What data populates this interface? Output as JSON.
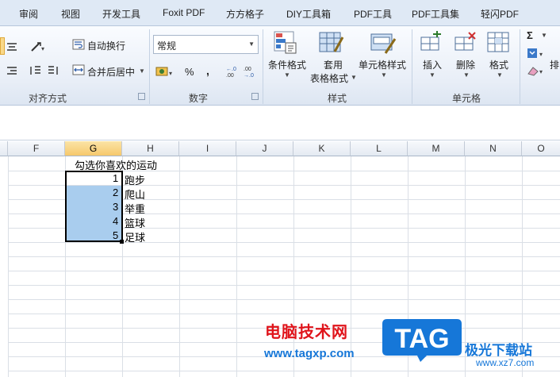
{
  "ribbon_tabs": [
    "审阅",
    "视图",
    "开发工具",
    "Foxit PDF",
    "方方格子",
    "DIY工具箱",
    "PDF工具",
    "PDF工具集",
    "轻闪PDF"
  ],
  "alignment": {
    "wrap_text": "自动换行",
    "merge_center": "合并后居中",
    "group_label": "对齐方式"
  },
  "number": {
    "format_value": "常规",
    "percent": "%",
    "comma": ",",
    "group_label": "数字"
  },
  "styles": {
    "conditional_format": "条件格式",
    "table_format_line1": "套用",
    "table_format_line2": "表格格式",
    "cell_styles": "单元格样式",
    "group_label": "样式"
  },
  "cells_group": {
    "insert": "插入",
    "delete": "删除",
    "format": "格式",
    "group_label": "单元格"
  },
  "editing": {
    "sort_label": "排"
  },
  "columns": [
    "F",
    "G",
    "H",
    "I",
    "J",
    "K",
    "L",
    "M",
    "N",
    "O"
  ],
  "sheet": {
    "title": "勾选你喜欢的运动",
    "rows": [
      {
        "num": "1",
        "sport": "跑步"
      },
      {
        "num": "2",
        "sport": "爬山"
      },
      {
        "num": "3",
        "sport": "举重"
      },
      {
        "num": "4",
        "sport": "篮球"
      },
      {
        "num": "5",
        "sport": "足球"
      }
    ]
  },
  "watermark": {
    "site_name": "电脑技术网",
    "url": "www.tagxp.com",
    "logo_text": "TAG",
    "brand": "极光下载站",
    "brand_url": "www.xz7.com"
  },
  "colors": {
    "selection": "#a9cdee",
    "selected_header": "#f6c86c",
    "watermark_red": "#e0141b",
    "watermark_blue": "#1677d8"
  }
}
